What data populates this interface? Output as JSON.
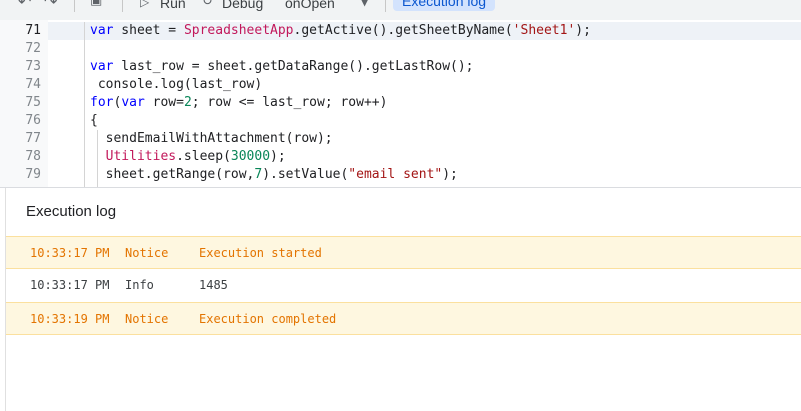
{
  "toolbar": {
    "undo_icon": "undo-icon",
    "redo_icon": "redo-icon",
    "save_icon": "save-icon",
    "run_label": "Run",
    "debug_label": "Debug",
    "function_select": "onOpen",
    "execution_log_label": "Execution log"
  },
  "editor": {
    "active_line": "71",
    "lines": [
      {
        "num": "71",
        "segments": [
          [
            "var",
            "k"
          ],
          [
            " sheet = ",
            ""
          ],
          [
            "SpreadsheetApp",
            "c"
          ],
          [
            ".getActive().getSheetByName(",
            ""
          ],
          [
            "'Sheet1'",
            "s"
          ],
          [
            ");",
            ""
          ]
        ]
      },
      {
        "num": "72",
        "segments": []
      },
      {
        "num": "73",
        "segments": [
          [
            "var",
            "k"
          ],
          [
            " last_row = sheet.getDataRange().getLastRow();",
            ""
          ]
        ]
      },
      {
        "num": "74",
        "segments": [
          [
            " console.log(last_row)",
            ""
          ]
        ]
      },
      {
        "num": "75",
        "segments": [
          [
            "for",
            "k"
          ],
          [
            "(",
            ""
          ],
          [
            "var",
            "k"
          ],
          [
            " row=",
            ""
          ],
          [
            "2",
            "n"
          ],
          [
            "; row <= last_row; row++)",
            ""
          ]
        ]
      },
      {
        "num": "76",
        "segments": [
          [
            "{",
            ""
          ]
        ]
      },
      {
        "num": "77",
        "segments": [
          [
            "  sendEmailWithAttachment(row);",
            ""
          ]
        ]
      },
      {
        "num": "78",
        "segments": [
          [
            "  ",
            ""
          ],
          [
            "Utilities",
            "c"
          ],
          [
            ".sleep(",
            ""
          ],
          [
            "30000",
            "n"
          ],
          [
            ");",
            ""
          ]
        ]
      },
      {
        "num": "79",
        "segments": [
          [
            "  sheet.getRange(row,",
            ""
          ],
          [
            "7",
            "n"
          ],
          [
            ").setValue(",
            ""
          ],
          [
            "\"email sent\"",
            "s"
          ],
          [
            ");",
            ""
          ]
        ]
      }
    ]
  },
  "log_panel": {
    "title": "Execution log",
    "entries": [
      {
        "time": "10:33:17 PM",
        "level": "Notice",
        "message": "Execution started"
      },
      {
        "time": "10:33:17 PM",
        "level": "Info",
        "message": "1485"
      },
      {
        "time": "10:33:19 PM",
        "level": "Notice",
        "message": "Execution completed"
      }
    ]
  },
  "colors": {
    "notice_background": "#fef7e0",
    "notice_text": "#e37400",
    "keyword": "#0000ff",
    "class_name": "#c2185b",
    "string": "#a31515",
    "number": "#098658",
    "chip_background": "#d3e3fd",
    "chip_text": "#0b57d0"
  }
}
